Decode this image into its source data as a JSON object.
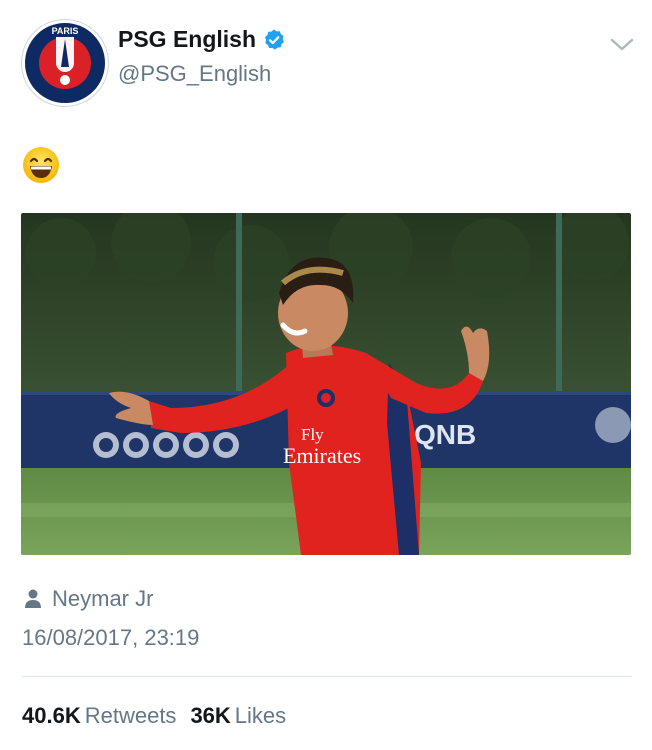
{
  "tweet": {
    "author": {
      "display_name": "PSG English",
      "handle": "@PSG_English",
      "avatar_logo": "PARIS SAINT-GERMAIN",
      "verified": true
    },
    "text_emoji": "grinning-face-with-smiling-eyes-emoji",
    "media": {
      "description_icon": "photo",
      "banner_texts": [
        "QNB"
      ],
      "shirt_text": "Fly Emirates"
    },
    "tagged_person": "Neymar Jr",
    "timestamp": "16/08/2017, 23:19",
    "stats": {
      "retweets_count": "40.6K",
      "retweets_label": "Retweets",
      "likes_count": "36K",
      "likes_label": "Likes"
    },
    "colors": {
      "verified_blue": "#1da1f2",
      "secondary_text": "#657786",
      "psg_navy": "#0e2a63",
      "psg_red": "#da2128"
    }
  }
}
